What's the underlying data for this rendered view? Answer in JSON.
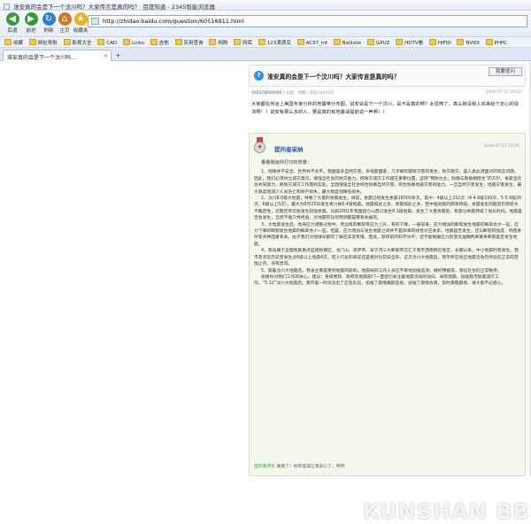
{
  "window": {
    "title": "淮安真的会是下一个汶川吗？大家传言是真的吗？_百度知道 - 2345智能浏览器"
  },
  "toolbar": {
    "back_label": "后退",
    "forward_label": "前进",
    "refresh_label": "刷新",
    "home_label": "主页",
    "fav_label": "收藏夹",
    "url": "http://zhidao.baidu.com/question/60516911.html"
  },
  "favorites": {
    "items": [
      "收藏",
      "网址导航",
      "影视大全",
      "CAD",
      "Links",
      "吉他",
      "实用查询",
      "网购",
      "网库",
      "123滴滴克",
      "AC97_int",
      "Ballistix",
      "GPUZ",
      "HDTV看",
      "HIFID",
      "NVIDI",
      "PHPC"
    ]
  },
  "tab": {
    "title": "淮安真的会是下一个汶川吗..."
  },
  "question": {
    "title": "淮安真的会是下一个汶川吗？大家传言是真的吗？",
    "ask_button": "我要提问",
    "meta_user": "100378000000",
    "meta_text": "| 分类：地震 | 浏览19416次",
    "date": "2008-07-15 16:03",
    "body": "大家都在传言上美国专家分析的地震带分布图，说安会是下一个汶川，是不是真的啊？太恐怖了，真么就没有人出来给个定心的说法啊！！说安有那么多的人，要是真的有地震请提前说一声啊！！"
  },
  "answer": {
    "answerer": "提问者采纳",
    "date": "2008-07-21 21:05",
    "intro": "看看我给你打印的背景：",
    "paragraphs": [
      "1、地球并不安全，世界并不太平。我国是多自然灾害，多地震国家，几乎每年都有灾害的发生，防灾救灾，是人类必须面对的现实问题。因此，我们必须树立减灾意识，增强全社会的抗灾能力，把防灾减灾工作摆在重要位置，坚持“预防为主，防御与救助相结合”的方针，依靠全社会共同努力，把防灾减灾工作落到实处，全面增强全社会综合防御自然灾害，综合防御地震灾害的能力，一旦自然灾害发生，地震灾害发生，最大限度地减少人员伤亡和财产损失，最大程度地降低损失。",
      "2、汶川8.0级大地震，导致了大量的余震发生，目前，余震已经发生余震16000多次，其中：4级以上232次（4-4.9级199次，5-5.9级26次，6级以上5次），最大为6月25日发生青川县6.4级地震。地震如此之多，余震如此之多，但中强地震的频率持续，余震发生的趋势仍有较大不确定性，近期还有可能发生较强余震。比如2001年我国昆仑山西口发生8.1级地震，发生了大量余震后，有部分余震持续了很长时间。地震是否会发生，当然不能只凭经验，对地震的任何预测都是要有依据的。",
      "3、大地震发生后，地壳应力调整过程中，周边有的断裂带应力上升，有的下降，一般说来，应力增加的断裂发生地震的概率会大一些，应力下降的断裂发生地震的概率会小一些。但是，应力增加与发生地震之间并不是简单的线性对应关系。地震是否发生，还与断裂的强度、构造条件等多种因素有关。由于我们对地球深部的了解还非常有限，因此，就目前的科学水平，还不能根据应力的变化准确判断某条断裂是否发生地震。",
      "4、我省属于全国地震重点监视防御区，龙门山、郯庐带、安宁河三大断裂带交汇于我市西南附近地区，长期以来，中小地震时有发生。我市及邻近历史曾发生过6级以上地震4次，但人们总的来说还是相对比较安全的，这次汶川大地震后，我市所在地区地震活动仍然处在正常的范围之内，没有异常。",
      "5、随着汶川大地震后，我省主要是受到地震的影响，地震局的工作人员在不断地加强监测，做好预报等，保证社会的正常秩序。",
      "谢谢你对我们工作的关心，建议：各级党政、政府及地震部门一直密切关注着地震活动的动向，采取措施，加强我市防震减灾工作，“5.12”汶川大地震后，我市第一时间派出了应急队伍，加强了震情跟踪监视，加强了震情会商，及时掌握震情，请大家不必担心。"
    ],
    "footer_label": "提问者评价",
    "footer_text": "谢谢了！你的答案让我安心了，呵呵"
  },
  "watermark": {
    "text": "KUNSHAN BBS"
  }
}
